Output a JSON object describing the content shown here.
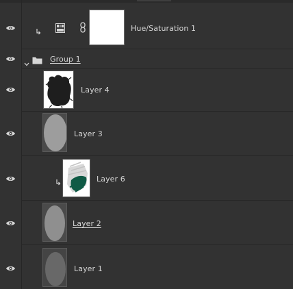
{
  "layers": [
    {
      "id": "hue-saturation-1",
      "name": "Hue/Saturation 1",
      "type": "adjustment",
      "visible": true,
      "clipped": true,
      "linked_mask": true
    },
    {
      "id": "group-1",
      "name": "Group 1",
      "type": "group",
      "visible": true,
      "expanded": true
    },
    {
      "id": "layer-4",
      "name": "Layer 4",
      "type": "pixel",
      "visible": true
    },
    {
      "id": "layer-3",
      "name": "Layer 3",
      "type": "pixel",
      "visible": true
    },
    {
      "id": "layer-6",
      "name": "Layer 6",
      "type": "pixel",
      "visible": true,
      "clipped": true
    },
    {
      "id": "layer-2",
      "name": "Layer 2",
      "type": "pixel",
      "visible": true
    },
    {
      "id": "layer-1",
      "name": "Layer 1",
      "type": "pixel",
      "visible": true
    }
  ],
  "colors": {
    "panel_bg": "#323232",
    "separator": "#262626",
    "text": "#d6d6d6",
    "layer6_accent": "#0f5a45"
  },
  "icons": {
    "visibility": "eye-icon",
    "clip": "clipping-arrow-icon",
    "adjustment": "hue-saturation-adjustment-icon",
    "link": "chain-link-icon",
    "folder": "folder-icon",
    "disclosure": "chevron-down-icon"
  }
}
